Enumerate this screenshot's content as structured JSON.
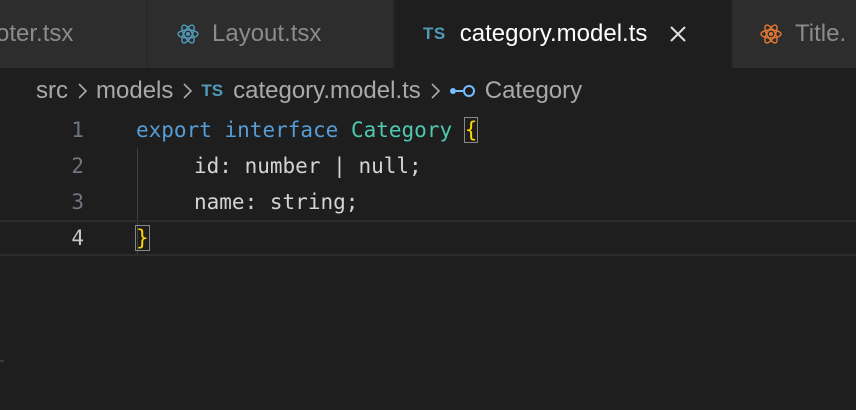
{
  "tabs": [
    {
      "label": "oter.tsx",
      "icon": "none",
      "active": false
    },
    {
      "label": "Layout.tsx",
      "icon": "react-icon",
      "active": false
    },
    {
      "label": "category.model.ts",
      "icon": "ts-icon",
      "badge": "TS",
      "active": true
    },
    {
      "label": "Title.",
      "icon": "react-icon",
      "active": false
    }
  ],
  "breadcrumb": {
    "items": [
      "src",
      "models",
      "category.model.ts",
      "Category"
    ],
    "file_badge": "TS"
  },
  "editor": {
    "line_numbers": [
      "1",
      "2",
      "3",
      "4"
    ],
    "lines": {
      "l1": {
        "kw1": "export",
        "kw2": "interface",
        "name": "Category",
        "brace": "{"
      },
      "l2": {
        "prop": "id",
        "colon": ":",
        "type1": "number",
        "pipe": "|",
        "type2": "null",
        "end": ";"
      },
      "l3": {
        "prop": "name",
        "colon": ":",
        "type": "string",
        "end": ";"
      },
      "l4": {
        "brace": "}"
      }
    },
    "active_line": 4
  },
  "colors": {
    "background": "#1e1e1e",
    "tabbar": "#252526",
    "inactive_tab": "#2d2d2d",
    "keyword": "#569cd6",
    "type_name": "#4ec9b0",
    "brace": "#ffd700",
    "ts_badge": "#519aba",
    "react": "#519aba",
    "react_orange": "#e37933"
  }
}
